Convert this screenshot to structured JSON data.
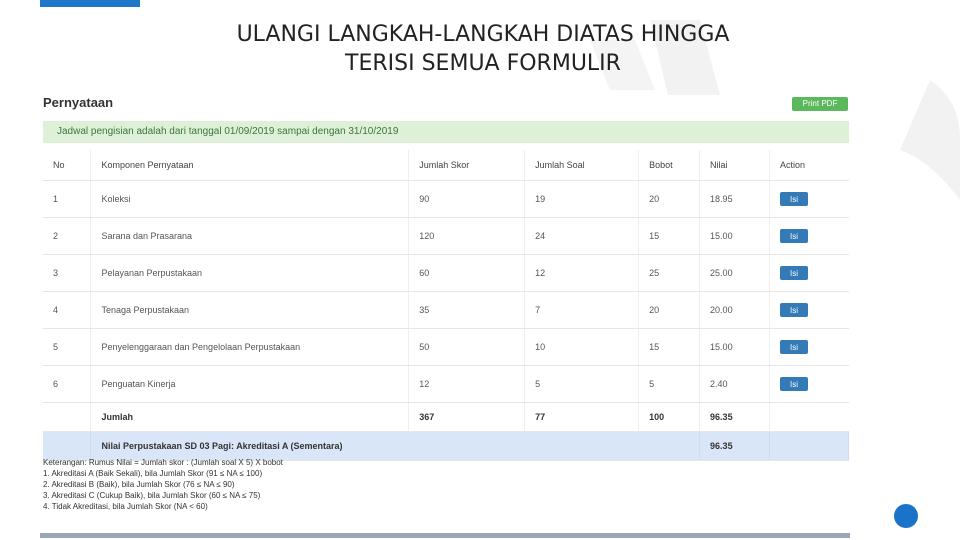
{
  "slide": {
    "title_line1": "ULANGI LANGKAH-LANGKAH DIATAS HINGGA",
    "title_line2": "TERISI SEMUA FORMULIR"
  },
  "panel": {
    "title": "Pernyataan",
    "print_label": "Print PDF",
    "schedule_text": "Jadwal pengisian adalah dari tanggal 01/09/2019 sampai dengan 31/10/2019"
  },
  "table": {
    "headers": [
      "No",
      "Komponen Pernyataan",
      "Jumlah Skor",
      "Jumlah Soal",
      "Bobot",
      "Nilai",
      "Action"
    ],
    "rows": [
      {
        "no": "1",
        "komponen": "Koleksi",
        "skor": "90",
        "soal": "19",
        "bobot": "20",
        "nilai": "18.95",
        "action": "Isi"
      },
      {
        "no": "2",
        "komponen": "Sarana dan Prasarana",
        "skor": "120",
        "soal": "24",
        "bobot": "15",
        "nilai": "15.00",
        "action": "Isi"
      },
      {
        "no": "3",
        "komponen": "Pelayanan Perpustakaan",
        "skor": "60",
        "soal": "12",
        "bobot": "25",
        "nilai": "25.00",
        "action": "Isi"
      },
      {
        "no": "4",
        "komponen": "Tenaga Perpustakaan",
        "skor": "35",
        "soal": "7",
        "bobot": "20",
        "nilai": "20.00",
        "action": "Isi"
      },
      {
        "no": "5",
        "komponen": "Penyelenggaraan dan Pengelolaan Perpustakaan",
        "skor": "50",
        "soal": "10",
        "bobot": "15",
        "nilai": "15.00",
        "action": "Isi"
      },
      {
        "no": "6",
        "komponen": "Penguatan Kinerja",
        "skor": "12",
        "soal": "5",
        "bobot": "5",
        "nilai": "2.40",
        "action": "Isi"
      }
    ],
    "total": {
      "label": "Jumlah",
      "skor": "367",
      "soal": "77",
      "bobot": "100",
      "nilai": "96.35"
    },
    "result": {
      "label": "Nilai Perpustakaan SD 03 Pagi: Akreditasi A (Sementara)",
      "nilai": "96.35"
    }
  },
  "notes": [
    "Keterangan: Rumus Nilai = Jumlah skor : (Jumlah soal X 5) X bobot",
    "1. Akreditasi A (Baik Sekali), bila Jumlah Skor (91 ≤ NA ≤ 100)",
    "2. Akreditasi B (Baik), bila Jumlah Skor (76 ≤ NA ≤ 90)",
    "3. Akreditasi C (Cukup Baik), bila Jumlah Skor (60 ≤ NA ≤ 75)",
    "4. Tidak Akreditasi, bila Jumlah Skor (NA < 60)"
  ],
  "colors": {
    "accent": "#1f77c9",
    "success": "#5cb85c",
    "primary": "#337ab7"
  }
}
